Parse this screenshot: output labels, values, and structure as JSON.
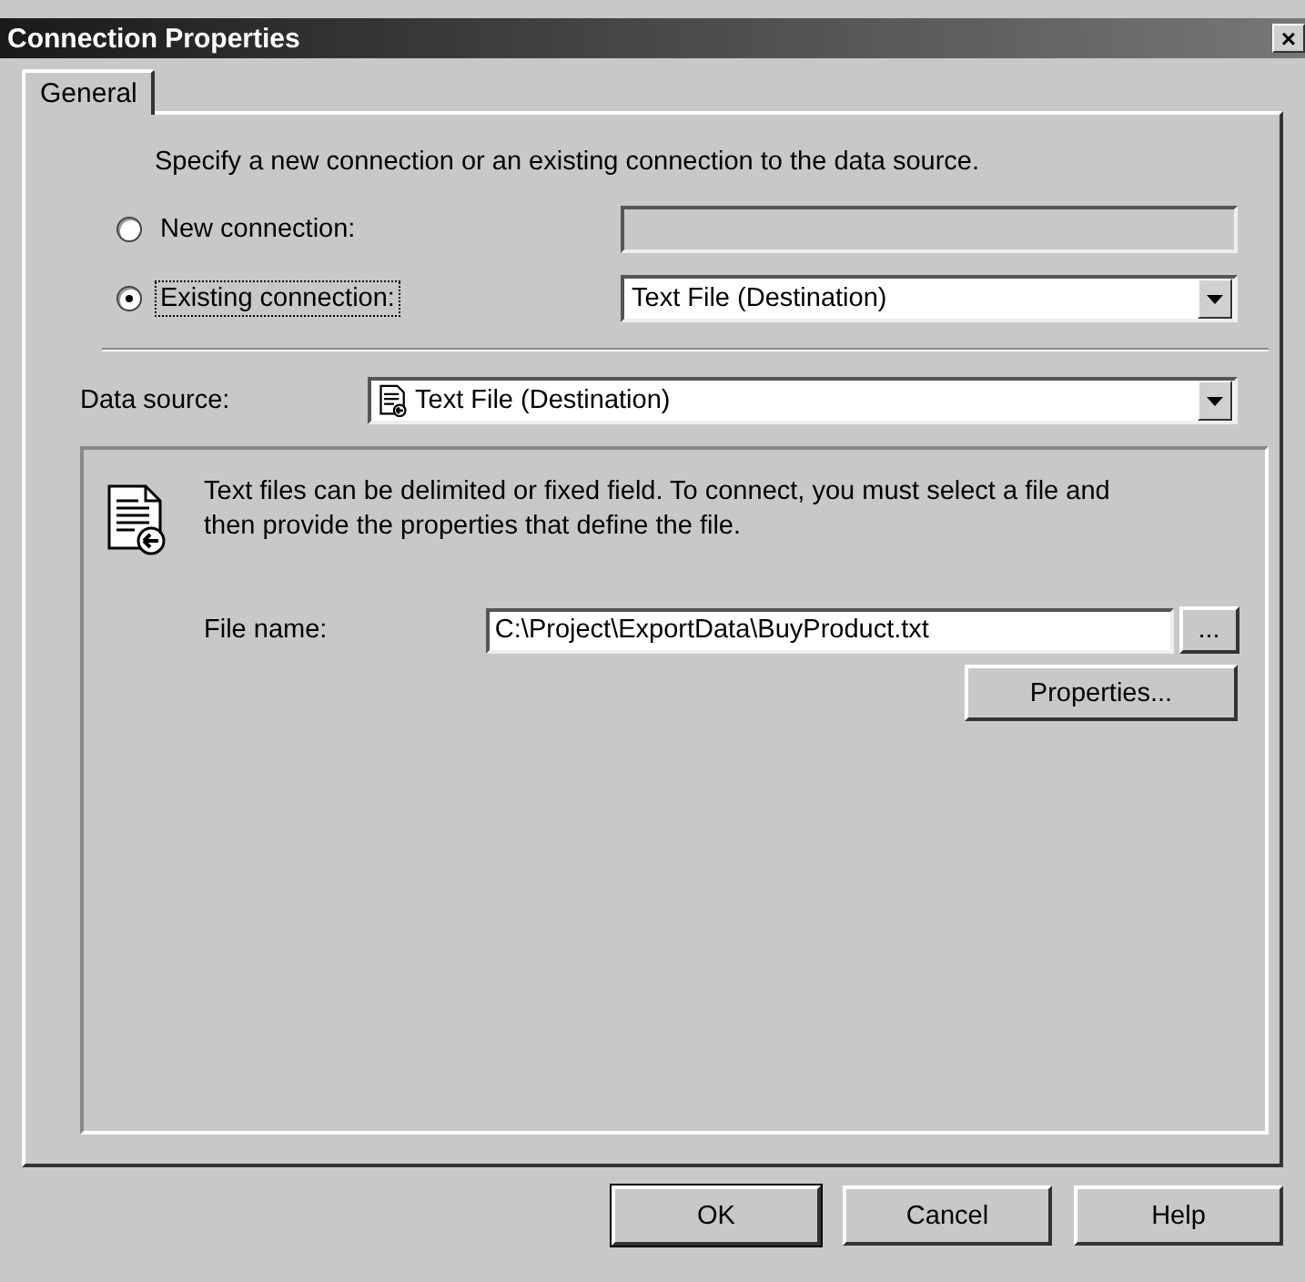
{
  "window": {
    "title": "Connection Properties",
    "close": "×"
  },
  "tabs": [
    {
      "label": "General",
      "selected": true
    }
  ],
  "instruction": "Specify a new connection or an existing connection to the data source.",
  "options": [
    {
      "label": "New connection:",
      "selected": false,
      "focused": false,
      "field": {
        "kind": "text",
        "disabled": true
      }
    },
    {
      "label": "Existing connection:",
      "selected": true,
      "focused": true,
      "field": {
        "kind": "combo",
        "value": "Text File (Destination)",
        "disabled": false
      }
    }
  ],
  "data_source": {
    "label": "Data source:",
    "value": "Text File (Destination)"
  },
  "description": "Text files can be delimited or fixed field. To connect, you must select a file and then provide the properties that define the file.",
  "file_name": {
    "label": "File name:",
    "value": "C:\\Project\\ExportData\\BuyProduct.txt",
    "browse": "..."
  },
  "properties_button": {
    "label": "Properties..."
  },
  "buttons": [
    {
      "label": "OK",
      "default": true
    },
    {
      "label": "Cancel",
      "default": false
    },
    {
      "label": "Help",
      "default": false
    }
  ]
}
